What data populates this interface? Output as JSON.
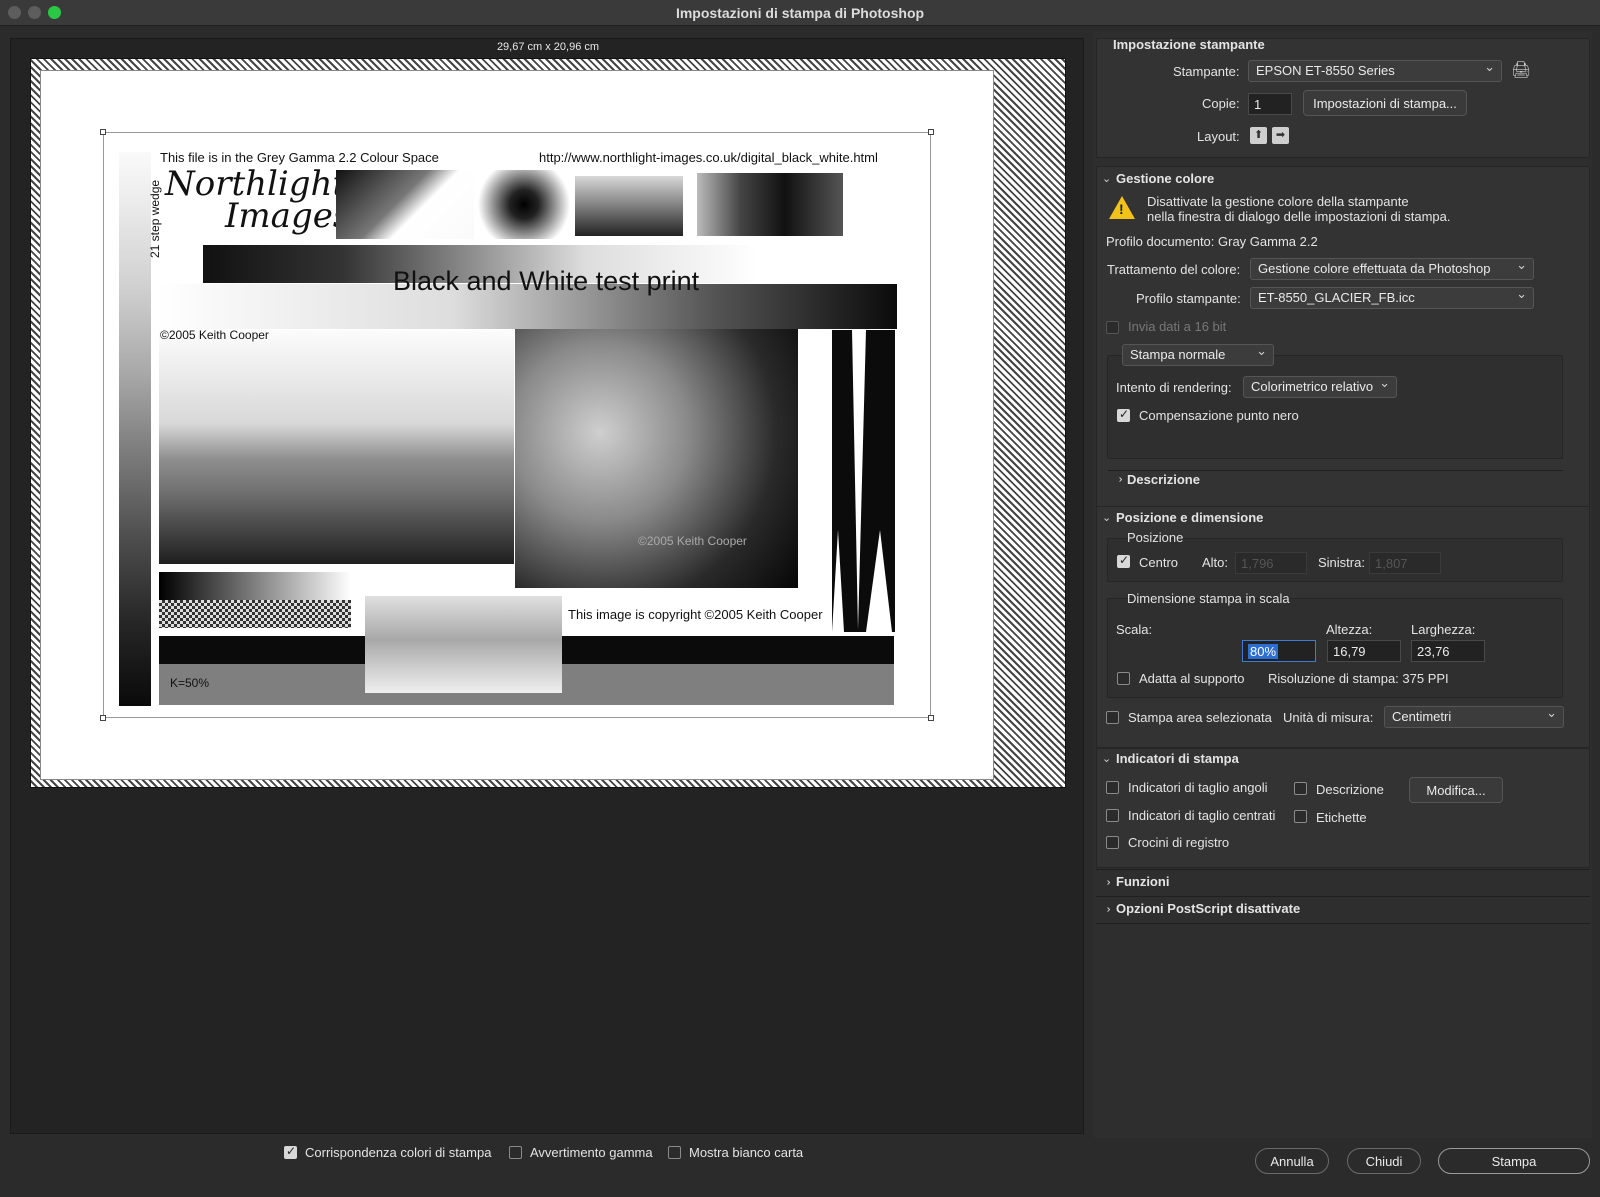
{
  "window": {
    "title": "Impostazioni di stampa di Photoshop"
  },
  "preview": {
    "size_label": "29,67 cm x 20,96 cm",
    "artwork": {
      "colour_space_text": "This file is in the Grey Gamma 2.2 Colour Space",
      "url_text": "http://www.northlight-images.co.uk/digital_black_white.html",
      "logo_line1": "Northlight",
      "logo_line2": "Images",
      "step_wedge_label": "21 step wedge",
      "main_title": "Black and White test print",
      "photo_copyright": "©2005 Keith Cooper",
      "ruin_watermark": "©2005 Keith Cooper",
      "image_copyright": "This image is copyright ©2005 Keith Cooper",
      "k_label": "K=50%"
    }
  },
  "printer_setup": {
    "heading": "Impostazione stampante",
    "printer_label": "Stampante:",
    "printer_value": "EPSON ET-8550 Series",
    "copies_label": "Copie:",
    "copies_value": "1",
    "print_settings_button": "Impostazioni di stampa...",
    "layout_label": "Layout:"
  },
  "color_management": {
    "heading": "Gestione colore",
    "warning_line1": "Disattivate la gestione colore della stampante",
    "warning_line2": "nella finestra di dialogo delle impostazioni di stampa.",
    "document_profile": "Profilo documento: Gray Gamma 2.2",
    "color_handling_label": "Trattamento del colore:",
    "color_handling_value": "Gestione colore effettuata da Photoshop",
    "printer_profile_label": "Profilo stampante:",
    "printer_profile_value": "ET-8550_GLACIER_FB.icc",
    "send_16bit_label": "Invia dati a 16 bit",
    "print_mode_value": "Stampa normale",
    "rendering_intent_label": "Intento di rendering:",
    "rendering_intent_value": "Colorimetrico relativo",
    "black_point_label": "Compensazione punto nero"
  },
  "description": {
    "heading": "Descrizione"
  },
  "position_size": {
    "heading": "Posizione e dimensione",
    "position_heading": "Posizione",
    "center_label": "Centro",
    "top_label": "Alto:",
    "top_value": "1,796",
    "left_label": "Sinistra:",
    "left_value": "1,807",
    "scaled_heading": "Dimensione stampa in scala",
    "scale_label": "Scala:",
    "height_label": "Altezza:",
    "width_label": "Larghezza:",
    "scale_value": "80%",
    "height_value": "16,79",
    "width_value": "23,76",
    "fit_media_label": "Adatta al supporto",
    "resolution_text": "Risoluzione di stampa: 375 PPI",
    "print_selected_label": "Stampa area selezionata",
    "units_label": "Unità di misura:",
    "units_value": "Centimetri"
  },
  "printing_marks": {
    "heading": "Indicatori di stampa",
    "corner_crop_label": "Indicatori di taglio angoli",
    "center_crop_label": "Indicatori di taglio centrati",
    "registration_label": "Crocini di registro",
    "description_label": "Descrizione",
    "labels_label": "Etichette",
    "edit_button": "Modifica..."
  },
  "functions": {
    "heading": "Funzioni"
  },
  "postscript": {
    "heading": "Opzioni PostScript disattivate"
  },
  "footer": {
    "match_colors_label": "Corrispondenza colori di stampa",
    "gamut_warning_label": "Avvertimento gamma",
    "paper_white_label": "Mostra bianco carta",
    "cancel_button": "Annulla",
    "close_button": "Chiudi",
    "print_button": "Stampa"
  }
}
